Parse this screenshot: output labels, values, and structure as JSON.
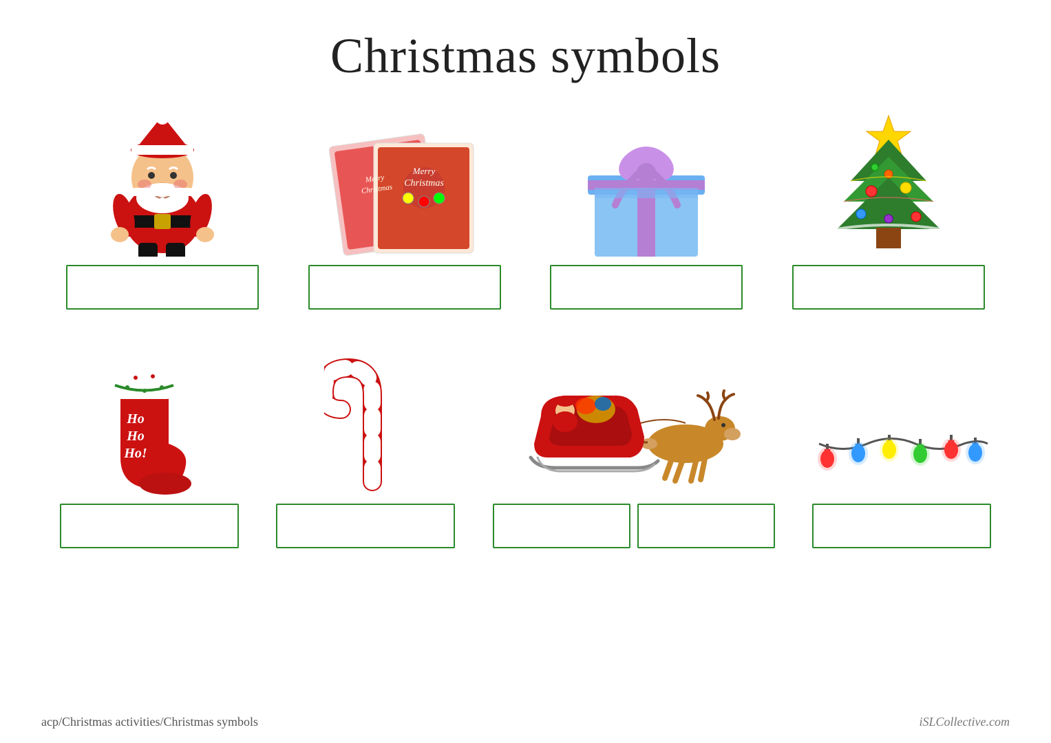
{
  "title": "Christmas symbols",
  "row1": {
    "items": [
      {
        "name": "santa-claus",
        "label": ""
      },
      {
        "name": "christmas-cards",
        "label": ""
      },
      {
        "name": "christmas-gift",
        "label": ""
      },
      {
        "name": "christmas-tree",
        "label": ""
      }
    ]
  },
  "row2": {
    "items": [
      {
        "name": "christmas-stocking",
        "label": ""
      },
      {
        "name": "candy-cane",
        "label": ""
      },
      {
        "name": "santa-sleigh",
        "label": ""
      },
      {
        "name": "reindeer",
        "label": ""
      },
      {
        "name": "christmas-lights",
        "label": ""
      }
    ]
  },
  "footer": {
    "left": "acp/Christmas activities/Christmas symbols",
    "right": "iSLCollective.com"
  }
}
